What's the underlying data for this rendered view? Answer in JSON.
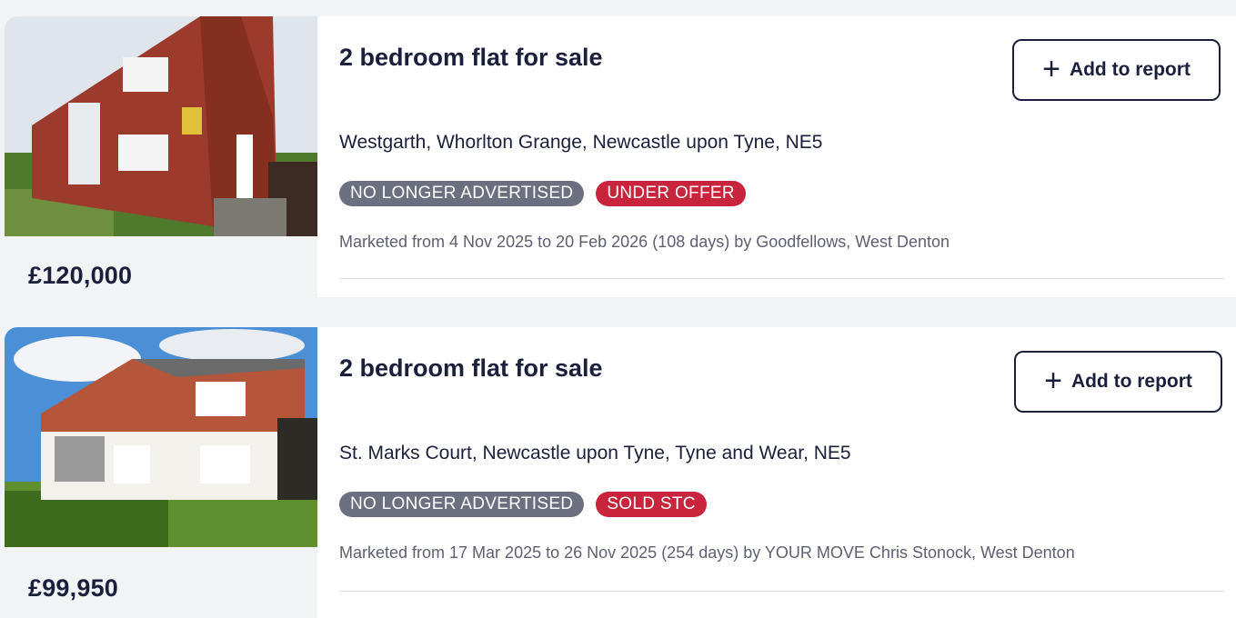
{
  "listings": [
    {
      "title": "2 bedroom flat for sale",
      "address": "Westgarth, Whorlton Grange, Newcastle upon Tyne, NE5",
      "badges": [
        "NO LONGER ADVERTISED",
        "UNDER OFFER"
      ],
      "marketed": "Marketed from 4 Nov 2025 to 20 Feb 2026 (108 days) by Goodfellows, West Denton",
      "price": "£120,000",
      "add_button": "Add to report"
    },
    {
      "title": "2 bedroom flat for sale",
      "address": "St. Marks Court, Newcastle upon Tyne, Tyne and Wear, NE5",
      "badges": [
        "NO LONGER ADVERTISED",
        "SOLD STC"
      ],
      "marketed": "Marketed from 17 Mar 2025 to 26 Nov 2025 (254 days) by YOUR MOVE Chris Stonock, West Denton",
      "price": "£99,950",
      "add_button": "Add to report"
    }
  ],
  "icons": {
    "add": "plus-icon"
  },
  "colors": {
    "text": "#1b1f3b",
    "badge_grey": "#6b6f80",
    "badge_red": "#c8253c",
    "muted": "#5d6072"
  }
}
